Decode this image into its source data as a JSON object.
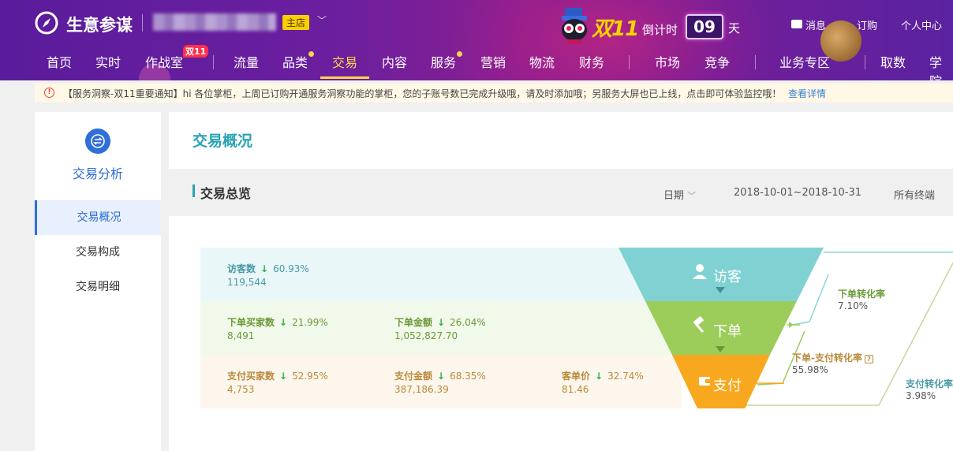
{
  "header": {
    "brand": "生意参谋",
    "shop_badge": "主店",
    "double11": "双11",
    "countdown_label": "倒计时",
    "countdown_value": "09",
    "countdown_unit": "天",
    "links": {
      "message": "消息",
      "order": "订购",
      "user_center": "个人中心"
    }
  },
  "nav": {
    "items": [
      "首页",
      "实时",
      "作战室",
      "流量",
      "品类",
      "交易",
      "内容",
      "服务",
      "营销",
      "物流",
      "财务",
      "市场",
      "竞争",
      "业务专区",
      "取数",
      "学院"
    ],
    "active": "交易",
    "war_room_badge": "双11"
  },
  "notice": {
    "text": "【服务洞察-双11重要通知】hi 各位掌柜，上周已订购开通服务洞察功能的掌柜，您的子账号数已完成升级哦，请及时添加哦；另服务大屏也已上线，点击即可体验监控哦！",
    "link": "查看详情"
  },
  "sidebar": {
    "title": "交易分析",
    "items": [
      "交易概况",
      "交易构成",
      "交易明细"
    ],
    "active_index": 0
  },
  "content": {
    "page_title": "交易概况",
    "section_title": "交易总览",
    "date_label": "日期",
    "date_range": "2018-10-01~2018-10-31",
    "terminal": "所有终端"
  },
  "metrics": {
    "visitors": {
      "name": "访客数",
      "change": "60.93%",
      "value": "119,544"
    },
    "order_buyers": {
      "name": "下单买家数",
      "change": "21.99%",
      "value": "8,491"
    },
    "order_amount": {
      "name": "下单金额",
      "change": "26.04%",
      "value": "1,052,827.70"
    },
    "pay_buyers": {
      "name": "支付买家数",
      "change": "52.95%",
      "value": "4,753"
    },
    "pay_amount": {
      "name": "支付金额",
      "change": "68.35%",
      "value": "387,186.39"
    },
    "unit_price": {
      "name": "客单价",
      "change": "32.74%",
      "value": "81.46"
    }
  },
  "funnel": {
    "stages": [
      "访客",
      "下单",
      "支付"
    ],
    "colors": [
      "#7fd0d0",
      "#9cce5a",
      "#f7a81e"
    ]
  },
  "conversions": {
    "order_rate": {
      "name": "下单转化率",
      "value": "7.10%"
    },
    "order_pay_rate": {
      "name": "下单-支付转化率",
      "value": "55.98%"
    },
    "pay_rate": {
      "name": "支付转化率",
      "value": "3.98%"
    }
  }
}
